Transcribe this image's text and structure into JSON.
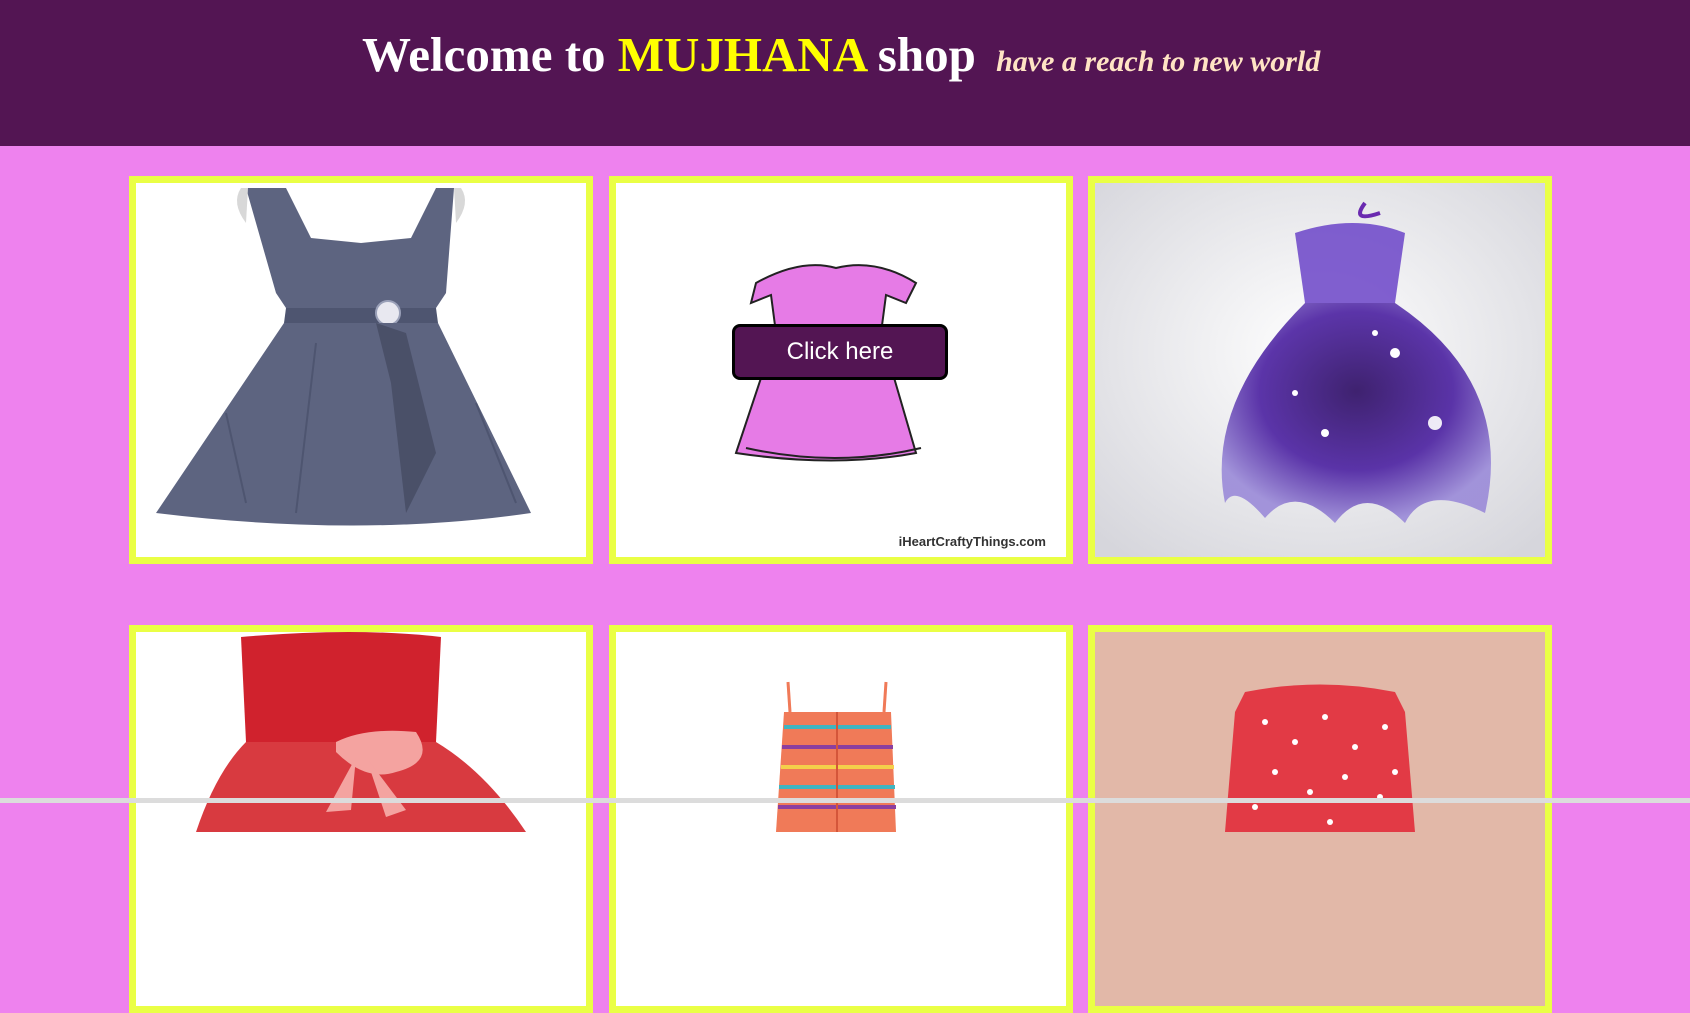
{
  "header": {
    "welcome_text": "Welcome to",
    "brand_name": "MUJHANA",
    "shop_text": "shop",
    "tagline": "have a reach to new world"
  },
  "products": [
    {
      "name": "grey-chiffon-dress",
      "dress_color": "#5d6480"
    },
    {
      "name": "pink-dress-drawing",
      "dress_color": "#e67be6",
      "button_label": "Click here",
      "watermark": "iHeartCraftyThings.com"
    },
    {
      "name": "purple-galaxy-dress",
      "dress_color": "#4a1fa0"
    },
    {
      "name": "red-bow-dress",
      "dress_color": "#d0222d"
    },
    {
      "name": "striped-bandeau-dress",
      "dress_color": "#f07a58"
    },
    {
      "name": "red-polka-dot-dress",
      "dress_color": "#e23a45"
    }
  ],
  "colors": {
    "header_bg": "#531553",
    "page_bg": "#ee82ee",
    "card_border": "#eaff45",
    "brand": "#ffff00",
    "tagline": "#ffe4c4",
    "button_bg": "#531553"
  }
}
